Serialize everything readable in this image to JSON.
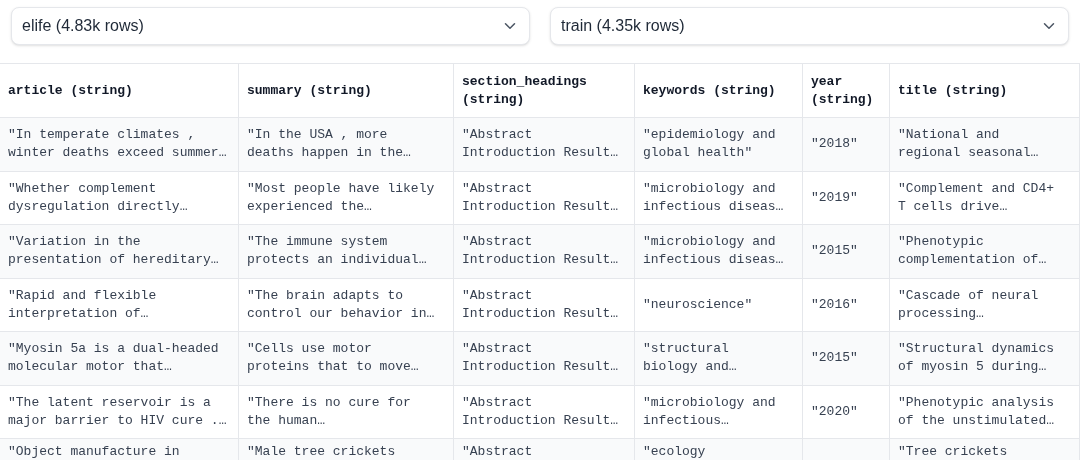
{
  "selects": [
    {
      "value": "elife (4.83k rows)"
    },
    {
      "value": "train (4.35k rows)"
    }
  ],
  "table": {
    "columns": [
      "article (string)",
      "summary (string)",
      "section_headings (string)",
      "keywords (string)",
      "year (string)",
      "title (string)"
    ],
    "rows": [
      {
        "article": "\"In temperate climates , winter deaths exceed summer…",
        "summary": "\"In the USA , more deaths happen in the…",
        "section_headings": "\"Abstract Introduction Result…",
        "keywords": "\"epidemiology and global health\"",
        "year": "\"2018\"",
        "title": "\"National and regional seasonal…"
      },
      {
        "article": "\"Whether complement dysregulation directly…",
        "summary": "\"Most people have likely experienced the…",
        "section_headings": "\"Abstract Introduction Result…",
        "keywords": "\"microbiology and infectious diseas…",
        "year": "\"2019\"",
        "title": "\"Complement and CD4+ T cells drive…"
      },
      {
        "article": "\"Variation in the presentation of hereditary…",
        "summary": "\"The immune system protects an individual…",
        "section_headings": "\"Abstract Introduction Result…",
        "keywords": "\"microbiology and infectious diseas…",
        "year": "\"2015\"",
        "title": "\"Phenotypic complementation of…"
      },
      {
        "article": "\"Rapid and flexible interpretation of…",
        "summary": "\"The brain adapts to control our behavior in…",
        "section_headings": "\"Abstract Introduction Result…",
        "keywords": "\"neuroscience\"",
        "year": "\"2016\"",
        "title": "\"Cascade of neural processing…"
      },
      {
        "article": "\"Myosin 5a is a dual-headed molecular motor that…",
        "summary": "\"Cells use motor proteins that to move…",
        "section_headings": "\"Abstract Introduction Result…",
        "keywords": "\"structural biology and…",
        "year": "\"2015\"",
        "title": "\"Structural dynamics of myosin 5 during…"
      },
      {
        "article": "\"The latent reservoir is a major barrier to HIV cure .…",
        "summary": "\"There is no cure for the human…",
        "section_headings": "\"Abstract Introduction Result…",
        "keywords": "\"microbiology and infectious…",
        "year": "\"2020\"",
        "title": "\"Phenotypic analysis of the unstimulated…"
      },
      {
        "article": "\"Object manufacture in",
        "summary": "\"Male tree crickets",
        "section_headings": "\"Abstract",
        "keywords": "\"ecology",
        "title": "\"Tree crickets"
      }
    ]
  }
}
